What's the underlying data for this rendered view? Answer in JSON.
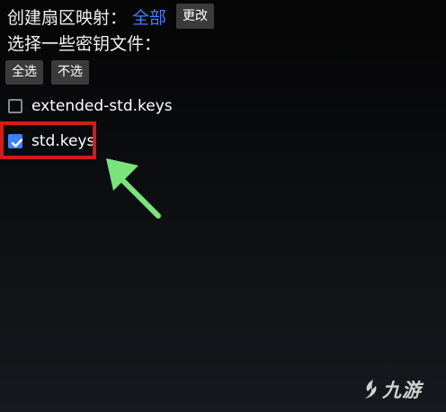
{
  "mapping": {
    "label": "创建扇区映射：",
    "value": "全部",
    "change_button": "更改"
  },
  "selection": {
    "label": "选择一些密钥文件：",
    "select_all": "全选",
    "select_none": "不选"
  },
  "files": [
    {
      "name": "extended-std.keys",
      "checked": false
    },
    {
      "name": "std.keys",
      "checked": true
    }
  ],
  "annotations": {
    "highlight_color": "#d21b1b",
    "arrow_color": "#7be37b"
  },
  "watermark": {
    "text": "九游",
    "icon": "jiuyou-logo-icon"
  },
  "colors": {
    "accent": "#4a7dff",
    "checkbox_checked": "#3b82f6",
    "button_bg": "#3b3b3b"
  }
}
